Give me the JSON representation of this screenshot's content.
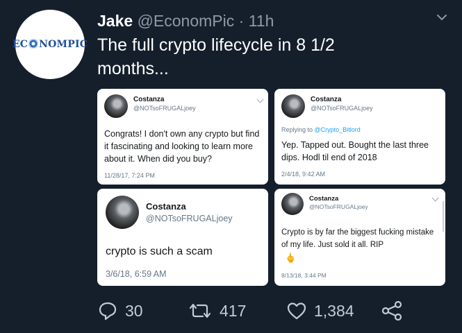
{
  "author": {
    "avatar_logo": "ECONOMPIC",
    "name": "Jake",
    "handle": "@EconomPic",
    "separator": "·",
    "time": "11h"
  },
  "tweet_text": "The full crypto lifecycle in 8 1/2 months...",
  "cards": [
    {
      "name": "Costanza",
      "handle": "@NOTsoFRUGALjoey",
      "text": "Congrats! I don't own any crypto but find it fascinating and looking to learn more about it. When did you buy?",
      "timestamp": "11/28/17, 7:24 PM"
    },
    {
      "name": "Costanza",
      "handle": "@NOTsoFRUGALjoey",
      "reply_prefix": "Replying to",
      "reply_to": "@Crypto_Bitlord",
      "text": "Yep. Tapped out. Bought the last three dips. Hodl til end of 2018",
      "timestamp": "2/4/18, 9:42 AM"
    },
    {
      "name": "Costanza",
      "handle": "@NOTsoFRUGALjoey",
      "text": "crypto is such a scam",
      "timestamp": "3/6/18, 6:59 AM"
    },
    {
      "name": "Costanza",
      "handle": "@NOTsoFRUGALjoey",
      "text": "Crypto is by far the biggest fucking mistake of my life. Just sold it all. RIP",
      "emoji": "🖕",
      "timestamp": "8/13/18, 3:44 PM"
    }
  ],
  "actions": {
    "replies": "30",
    "retweets": "417",
    "likes": "1,384"
  },
  "icons": [
    "reply-icon",
    "retweet-icon",
    "like-icon",
    "share-icon",
    "chevron-down-icon"
  ],
  "colors": {
    "background": "#151f2b",
    "text_secondary": "#8f9aa6",
    "link": "#1da1f2"
  }
}
